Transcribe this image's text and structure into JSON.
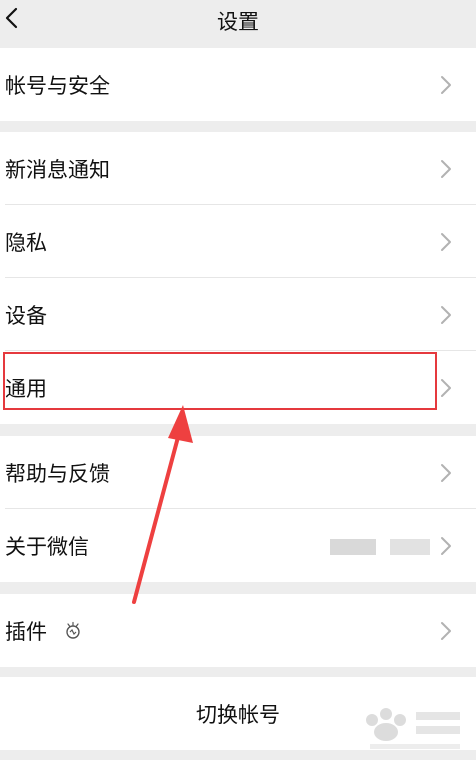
{
  "nav": {
    "title": "设置",
    "back_icon": "chevron-left-icon"
  },
  "groups": [
    {
      "items": [
        {
          "label": "帐号与安全"
        }
      ]
    },
    {
      "items": [
        {
          "label": "新消息通知"
        },
        {
          "label": "隐私"
        },
        {
          "label": "设备"
        },
        {
          "label": "通用"
        }
      ]
    },
    {
      "items": [
        {
          "label": "帮助与反馈"
        },
        {
          "label": "关于微信"
        }
      ]
    },
    {
      "items": [
        {
          "label": "插件",
          "icon": "plugin-bulb-icon"
        }
      ]
    }
  ],
  "switch_account": {
    "label": "切换帐号"
  },
  "colors": {
    "background": "#ededed",
    "card": "#ffffff",
    "highlight": "#e5393e",
    "chevron": "#b2b2b2"
  }
}
